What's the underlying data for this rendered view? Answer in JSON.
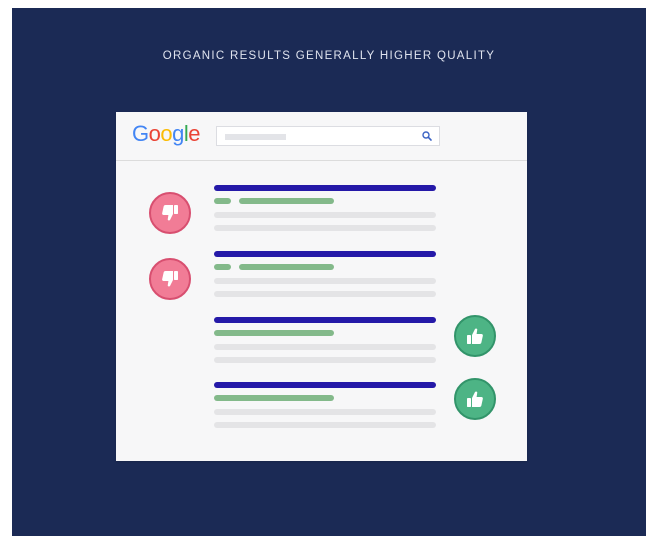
{
  "headline": "ORGANIC RESULTS GENERALLY HIGHER QUALITY",
  "logo": {
    "letters": [
      "G",
      "o",
      "o",
      "g",
      "l",
      "e"
    ],
    "colors": [
      "#4285F4",
      "#EA4335",
      "#FBBC05",
      "#4285F4",
      "#34A853",
      "#EA4335"
    ]
  },
  "search_icon": "search-icon",
  "results": [
    {
      "vote": "thumbs-down",
      "vote_color": "#f17c96"
    },
    {
      "vote": "thumbs-down",
      "vote_color": "#f17c96"
    },
    {
      "vote": "thumbs-up",
      "vote_color": "#4db485"
    },
    {
      "vote": "thumbs-up",
      "vote_color": "#4db485"
    }
  ],
  "colors": {
    "background": "#1b2a55",
    "title_link": "#2519a8",
    "url": "#83b98a",
    "snippet": "#e4e4e6"
  }
}
